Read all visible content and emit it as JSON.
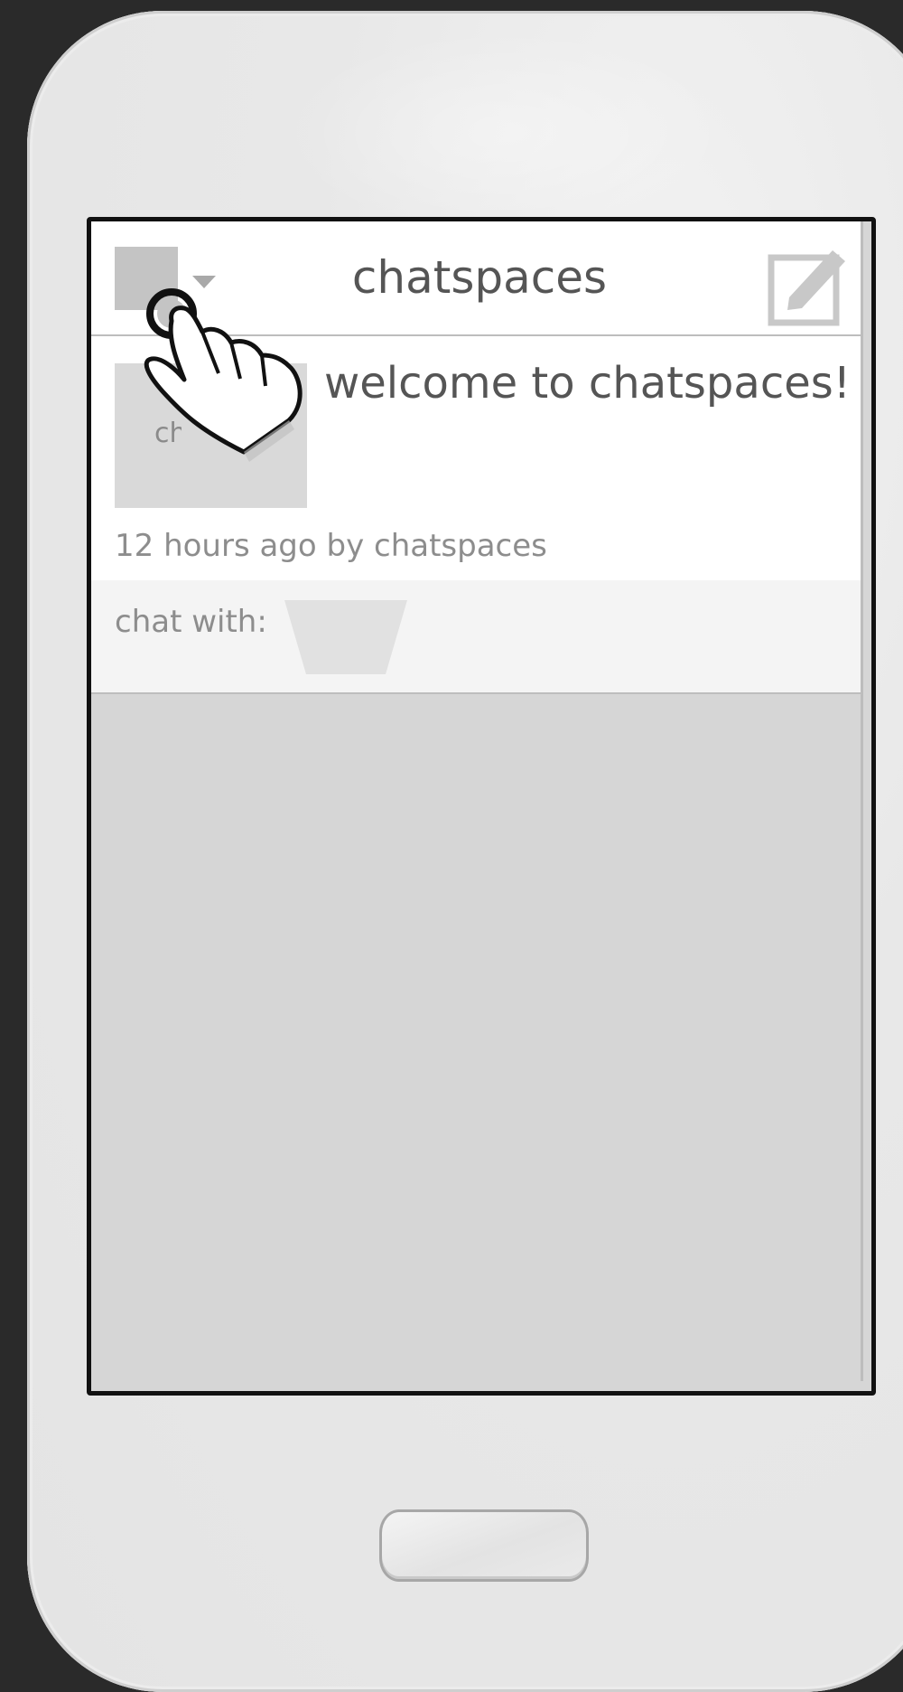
{
  "header": {
    "title": "chatspaces",
    "account_icon": "account-square-icon",
    "dropdown_icon": "chevron-down-icon",
    "compose_icon": "compose-icon"
  },
  "post": {
    "thumbnail_text": "chatspaces",
    "title": "welcome to chatspaces!",
    "meta": "12 hours ago by chatspaces"
  },
  "chat": {
    "label": "chat with:",
    "picker_icon": "trapezoid-picker-icon"
  },
  "overlay": {
    "gesture_icon": "tap-hand-icon"
  },
  "device": {
    "home_button_icon": "home-button-icon"
  },
  "colors": {
    "background": "#2a2a2a",
    "phone_body": "#e8e8e8",
    "text_primary": "#555555",
    "text_secondary": "#8d8d8d",
    "placeholder_gray": "#c4c4c4"
  }
}
